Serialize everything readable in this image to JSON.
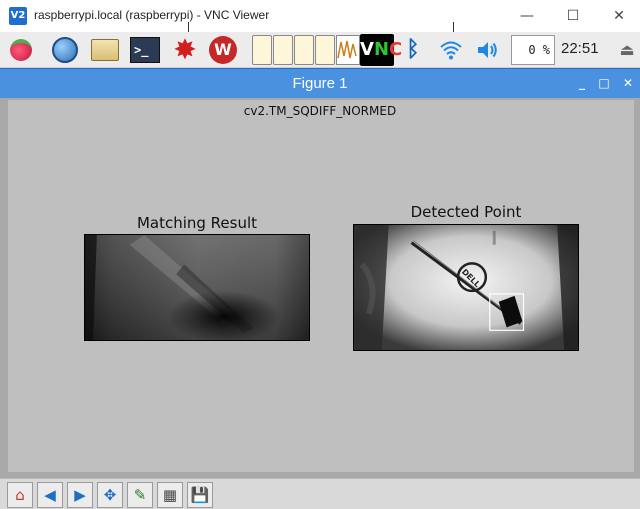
{
  "vnc_window": {
    "app_icon": "V2",
    "title": "raspberrypi.local (raspberrypi) - VNC Viewer",
    "minimize_glyph": "—",
    "maximize_glyph": "☐",
    "close_glyph": "✕"
  },
  "taskbar": {
    "icons": [
      "raspberry-menu-icon",
      "globe-browser-icon",
      "file-manager-folder-icon",
      "terminal-icon",
      "red-burst-icon",
      "wolfram-icon",
      "open-window-icon",
      "open-window-icon",
      "open-window-icon",
      "open-window-icon",
      "chart-window-icon",
      "vnc-server-icon",
      "bluetooth-icon",
      "wifi-icon",
      "volume-icon",
      "eject-icon"
    ],
    "terminal_glyph": ">_",
    "bluetooth_glyph": "ᛒ",
    "wifi_glyph": "◠",
    "volume_glyph": "🔈",
    "eject_glyph": "⏏",
    "burst_glyph": "✸",
    "vnc_letters": [
      "V",
      "N",
      "C"
    ],
    "cpu_usage": "0 %",
    "clock": "22:51"
  },
  "figure": {
    "window_title": "Figure 1",
    "suptitle": "cv2.TM_SQDIFF_NORMED",
    "left_subplot_title": "Matching Result",
    "right_subplot_title": "Detected Point",
    "dell_logo_text": "DELL",
    "controls": {
      "minimize": "_",
      "maximize": "□",
      "close": "✕"
    }
  },
  "toolbar": {
    "buttons": [
      "home-icon",
      "back-arrow-icon",
      "forward-arrow-icon",
      "pan-move-icon",
      "zoom-rect-icon",
      "subplots-config-icon",
      "save-floppy-icon"
    ],
    "glyphs": {
      "home": "⌂",
      "back": "◀",
      "forward": "▶",
      "pan": "✥",
      "zoom": "✎",
      "subplots": "▦",
      "save": "💾"
    }
  },
  "colors": {
    "figure_titlebar": "#4a92e0",
    "figure_bg": "#bfbfbf",
    "taskbar_bg": "#ececec"
  }
}
